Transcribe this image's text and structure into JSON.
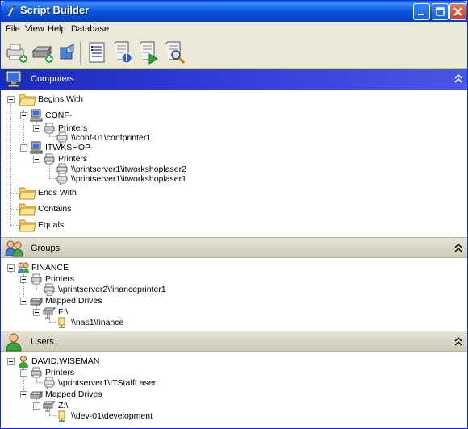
{
  "window": {
    "title": "Script Builder"
  },
  "menu": {
    "file": "File",
    "view": "View",
    "help": "Help",
    "database": "Database"
  },
  "toolbar": {
    "tools": [
      "add-printer-icon",
      "add-drive-icon",
      "add-group-icon",
      "script-list-icon",
      "script-info-icon",
      "script-run-icon",
      "script-search-icon"
    ]
  },
  "computers": {
    "header": "Computers",
    "begins_with": "Begins With",
    "conf": "CONF-",
    "conf_printers": "Printers",
    "conf_printer1": "\\\\conf-01\\confprinter1",
    "itwk": "ITWKSHOP-",
    "itwk_printers": "Printers",
    "itwk_printer1": "\\\\printserver1\\itworkshoplaser2",
    "itwk_printer2": "\\\\printserver1\\itworkshoplaser1",
    "ends_with": "Ends With",
    "contains": "Contains",
    "equals": "Equals"
  },
  "groups": {
    "header": "Groups",
    "finance": "FINANCE",
    "printers": "Printers",
    "printer1": "\\\\printserver2\\financeprinter1",
    "mapped_drives": "Mapped Drives",
    "drive": "F:\\",
    "share": "\\\\nas1\\finance"
  },
  "users": {
    "header": "Users",
    "user": "DAVID.WISEMAN",
    "printers": "Printers",
    "printer1": "\\\\printserver1\\ITStaffLaser",
    "mapped_drives": "Mapped Drives",
    "drive": "Z:\\",
    "share": "\\\\dev-01\\development"
  }
}
